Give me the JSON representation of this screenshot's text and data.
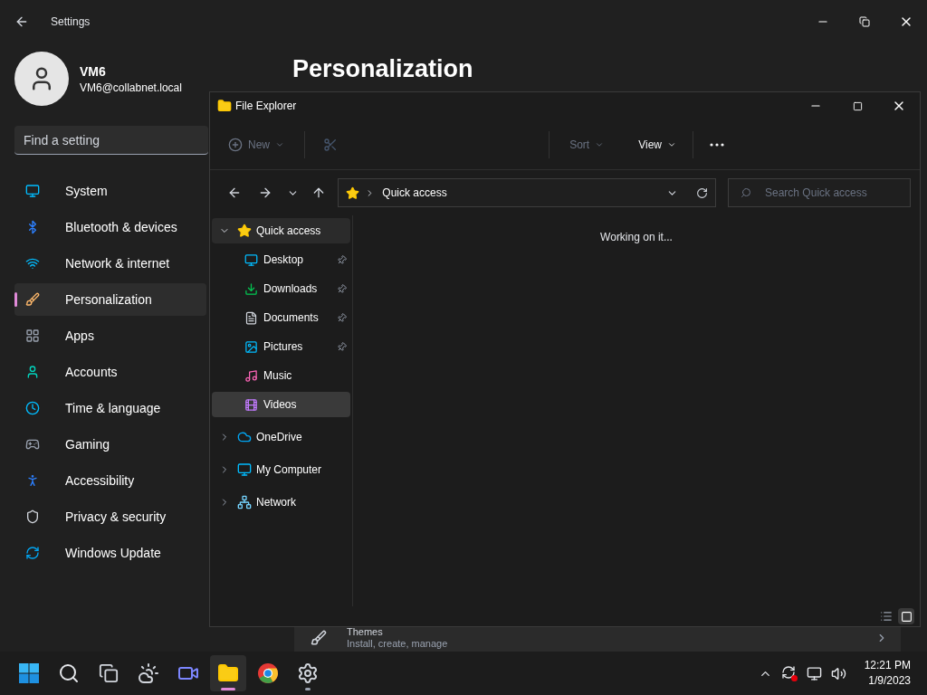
{
  "settings": {
    "title": "Settings",
    "user": {
      "name": "VM6",
      "email": "VM6@collabnet.local"
    },
    "search": {
      "placeholder": "Find a setting"
    },
    "nav": [
      {
        "label": "System",
        "selected": false
      },
      {
        "label": "Bluetooth & devices",
        "selected": false
      },
      {
        "label": "Network & internet",
        "selected": false
      },
      {
        "label": "Personalization",
        "selected": true
      },
      {
        "label": "Apps",
        "selected": false
      },
      {
        "label": "Accounts",
        "selected": false
      },
      {
        "label": "Time & language",
        "selected": false
      },
      {
        "label": "Gaming",
        "selected": false
      },
      {
        "label": "Accessibility",
        "selected": false
      },
      {
        "label": "Privacy & security",
        "selected": false
      },
      {
        "label": "Windows Update",
        "selected": false
      }
    ],
    "page_title": "Personalization",
    "themes_row": {
      "title": "Themes",
      "description": "Install, create, manage"
    }
  },
  "explorer": {
    "title": "File Explorer",
    "toolbar": [
      {
        "kind": "new",
        "label": "New",
        "disabled": true
      },
      {
        "kind": "cut",
        "disabled": true
      },
      {
        "kind": "sort",
        "label": "Sort",
        "disabled": true
      },
      {
        "kind": "view",
        "label": "View",
        "disabled": false
      },
      {
        "kind": "more"
      }
    ],
    "address": "Quick access",
    "search": {
      "placeholder": "Search Quick access"
    },
    "tree": [
      {
        "label": "Quick access",
        "expanded": true,
        "selected": true,
        "children": [
          {
            "label": "Desktop",
            "pinned": true,
            "hovered": false
          },
          {
            "label": "Downloads",
            "pinned": true,
            "hovered": false
          },
          {
            "label": "Documents",
            "pinned": true,
            "hovered": false
          },
          {
            "label": "Pictures",
            "pinned": true,
            "hovered": false
          },
          {
            "label": "Music",
            "pinned": false,
            "hovered": false
          },
          {
            "label": "Videos",
            "pinned": false,
            "hovered": true
          }
        ]
      },
      {
        "label": "OneDrive",
        "expanded": false,
        "selected": false
      },
      {
        "label": "My Computer",
        "expanded": false,
        "selected": false
      },
      {
        "label": "Network",
        "expanded": false,
        "selected": false
      }
    ],
    "status": "Working on it...",
    "view_modes": [
      {
        "selected": false
      },
      {
        "selected": true
      }
    ]
  },
  "taskbar": {
    "apps": [
      {
        "active": false,
        "running": false
      },
      {
        "active": false,
        "running": false
      },
      {
        "active": false,
        "running": false
      },
      {
        "active": false,
        "running": false
      },
      {
        "active": false,
        "running": false
      },
      {
        "active": true,
        "running": true
      },
      {
        "active": false,
        "running": false
      },
      {
        "active": false,
        "running": true
      }
    ],
    "time": "12:21 PM",
    "date": "1/9/2023"
  }
}
